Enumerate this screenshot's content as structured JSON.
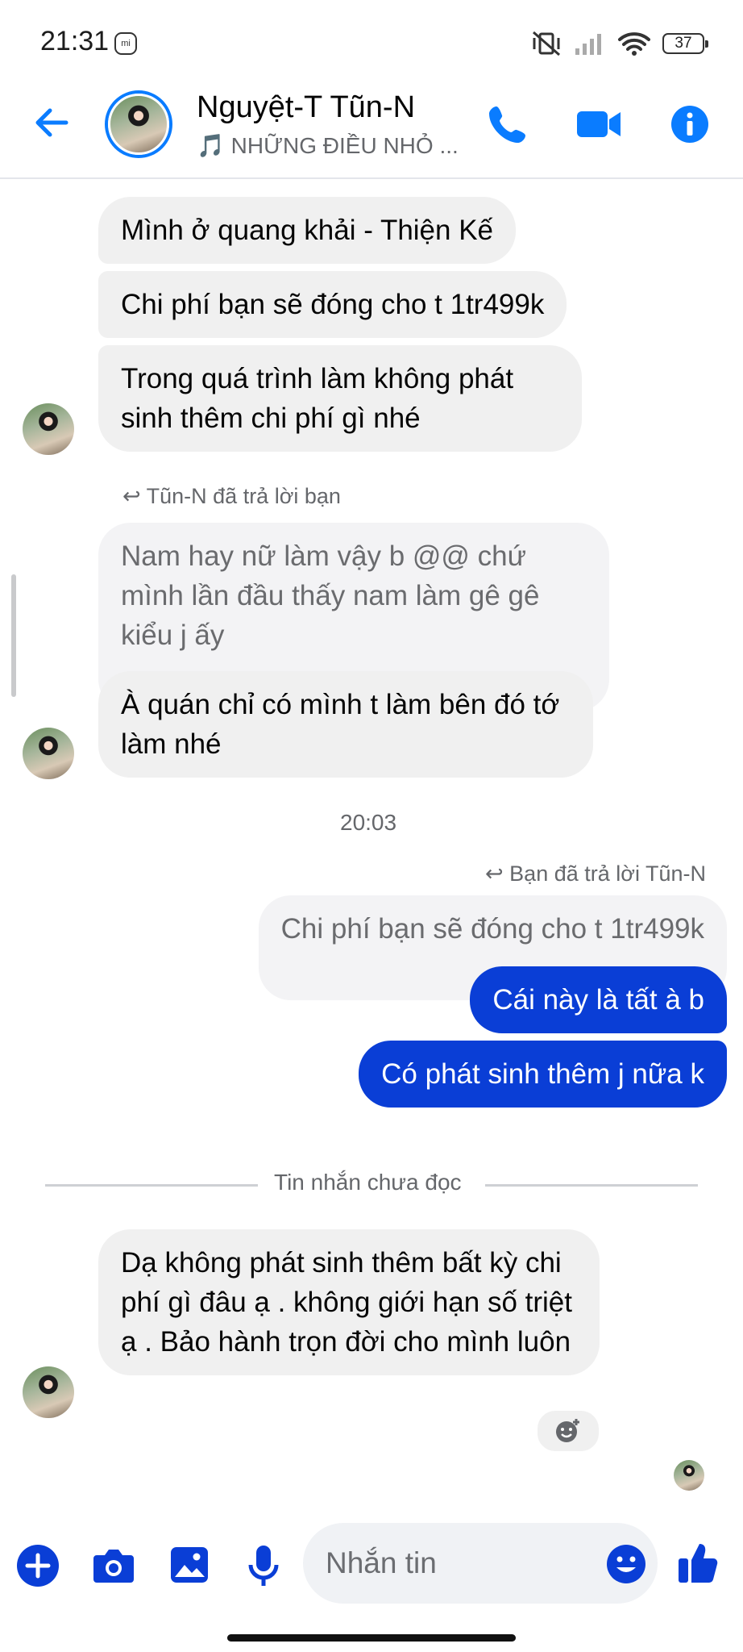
{
  "status_bar": {
    "time": "21:31",
    "battery": "37"
  },
  "header": {
    "contact_name": "Nguyệt-T Tũn-N",
    "now_playing": "🎵 NHỮNG ĐIỀU NHỎ ..."
  },
  "messages": {
    "m1": "Mình ở quang khải - Thiện Kế",
    "m2": "Chi phí bạn sẽ đóng cho t 1tr499k",
    "m3": "Trong quá trình làm không phát sinh thêm chi phí gì nhé",
    "reply_note_1": "Tũn-N đã trả lời bạn",
    "quoted_1": "Nam hay nữ làm vậy b @@ chứ mình lần đầu thấy nam làm gê gê kiểu j ấy",
    "m4": "À quán chỉ có mình t làm bên đó tớ làm nhé",
    "timestamp": "20:03",
    "reply_note_2": "Bạn đã trả lời Tũn-N",
    "quoted_2": "Chi phí bạn sẽ đóng cho t 1tr499k",
    "mine_1": "Cái này là tất à b",
    "mine_2": "Có phát sinh thêm j nữa k",
    "unread_divider": "Tin nhắn chưa đọc",
    "m5": "Dạ không phát sinh thêm bất kỳ chi phí gì đâu ạ . không giới hạn số triệt ạ . Bảo hành trọn đời cho mình luôn"
  },
  "composer": {
    "placeholder": "Nhắn tin"
  },
  "colors": {
    "accent": "#0a7cff",
    "my_bubble": "#0a3ed6",
    "their_bubble": "#f0f0f0"
  }
}
